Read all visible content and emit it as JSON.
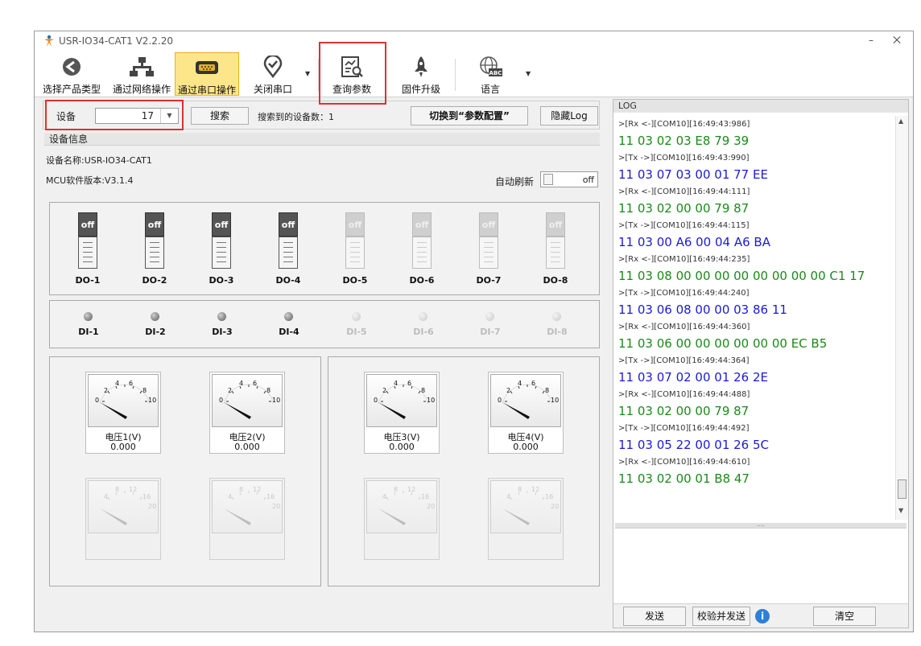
{
  "window": {
    "title": "USR-IO34-CAT1 V2.2.20",
    "minimize": "–",
    "close": "⨉"
  },
  "ribbon": {
    "buttons": [
      {
        "label": "选择产品类型",
        "icon": "back-arrow-icon"
      },
      {
        "label": "通过网络操作",
        "icon": "network-icon"
      },
      {
        "label": "通过串口操作",
        "icon": "serial-port-icon",
        "active": true
      },
      {
        "label": "关闭串口",
        "icon": "location-check-icon"
      },
      {
        "label": "查询参数",
        "icon": "query-document-icon"
      },
      {
        "label": "固件升级",
        "icon": "rocket-icon"
      },
      {
        "label": "语言",
        "icon": "globe-abc-icon"
      }
    ]
  },
  "device_bar": {
    "device_label": "设备",
    "device_value": "17",
    "search_button": "搜索",
    "found_label": "搜索到的设备数：",
    "found_count": "1",
    "switch_button": "切换到“参数配置”",
    "hide_log_button": "隐藏Log"
  },
  "device_info": {
    "header": "设备信息",
    "name": "设备名称:USR-IO34-CAT1",
    "mcu_version": "MCU软件版本:V3.1.4",
    "auto_refresh_label": "自动刷新",
    "auto_refresh_value": "off"
  },
  "outputs": [
    {
      "label": "DO-1",
      "state": "off",
      "enabled": true
    },
    {
      "label": "DO-2",
      "state": "off",
      "enabled": true
    },
    {
      "label": "DO-3",
      "state": "off",
      "enabled": true
    },
    {
      "label": "DO-4",
      "state": "off",
      "enabled": true
    },
    {
      "label": "DO-5",
      "state": "off",
      "enabled": false
    },
    {
      "label": "DO-6",
      "state": "off",
      "enabled": false
    },
    {
      "label": "DO-7",
      "state": "off",
      "enabled": false
    },
    {
      "label": "DO-8",
      "state": "off",
      "enabled": false
    }
  ],
  "inputs": [
    {
      "label": "DI-1",
      "enabled": true
    },
    {
      "label": "DI-2",
      "enabled": true
    },
    {
      "label": "DI-3",
      "enabled": true
    },
    {
      "label": "DI-4",
      "enabled": true
    },
    {
      "label": "DI-5",
      "enabled": false
    },
    {
      "label": "DI-6",
      "enabled": false
    },
    {
      "label": "DI-7",
      "enabled": false
    },
    {
      "label": "DI-8",
      "enabled": false
    }
  ],
  "gauge_scale": {
    "t0": "0",
    "t2": "2",
    "t4": "4",
    "t6": "6",
    "t8": "8",
    "t10": "10"
  },
  "gauge_scale_dim": {
    "t4": "4",
    "t8": "8",
    "t12": "12",
    "t16": "16",
    "t20": "20"
  },
  "gauges": [
    {
      "name": "电压1(V)",
      "value": "0.000"
    },
    {
      "name": "电压2(V)",
      "value": "0.000"
    },
    {
      "name": "电压3(V)",
      "value": "0.000"
    },
    {
      "name": "电压4(V)",
      "value": "0.000"
    }
  ],
  "log": {
    "header": "LOG",
    "lines": [
      {
        "type": "small",
        "text": ">[Rx <-][COM10][16:49:43:986]"
      },
      {
        "type": "rx",
        "text": "11 03 02 03 E8 79 39"
      },
      {
        "type": "small",
        "text": ">[Tx ->][COM10][16:49:43:990]"
      },
      {
        "type": "tx",
        "text": "11 03 07 03 00 01 77 EE"
      },
      {
        "type": "small",
        "text": ">[Rx <-][COM10][16:49:44:111]"
      },
      {
        "type": "rx",
        "text": "11 03 02 00 00 79 87"
      },
      {
        "type": "small",
        "text": ">[Tx ->][COM10][16:49:44:115]"
      },
      {
        "type": "tx",
        "text": "11 03 00 A6 00 04 A6 BA"
      },
      {
        "type": "small",
        "text": ">[Rx <-][COM10][16:49:44:235]"
      },
      {
        "type": "rx",
        "text": "11 03 08 00 00 00 00 00 00 00 00 C1 17"
      },
      {
        "type": "small",
        "text": ">[Tx ->][COM10][16:49:44:240]"
      },
      {
        "type": "tx",
        "text": "11 03 06 08 00 00 03 86 11"
      },
      {
        "type": "small",
        "text": ">[Rx <-][COM10][16:49:44:360]"
      },
      {
        "type": "rx",
        "text": "11 03 06 00 00 00 00 00 00 EC B5"
      },
      {
        "type": "small",
        "text": ">[Tx ->][COM10][16:49:44:364]"
      },
      {
        "type": "tx",
        "text": "11 03 07 02 00 01 26 2E"
      },
      {
        "type": "small",
        "text": ">[Rx <-][COM10][16:49:44:488]"
      },
      {
        "type": "rx",
        "text": "11 03 02 00 00 79 87"
      },
      {
        "type": "small",
        "text": ">[Tx ->][COM10][16:49:44:492]"
      },
      {
        "type": "tx",
        "text": "11 03 05 22 00 01 26 5C"
      },
      {
        "type": "small",
        "text": ">[Rx <-][COM10][16:49:44:610]"
      },
      {
        "type": "rx",
        "text": "11 03 02 00 01 B8 47"
      }
    ],
    "splitter": "....",
    "send_button": "发送",
    "verify_send_button": "校验并发送",
    "info_icon": "i",
    "clear_button": "清空"
  }
}
